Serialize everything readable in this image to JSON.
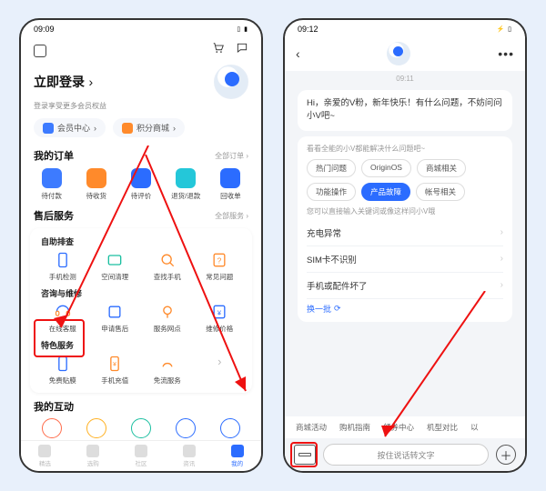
{
  "left": {
    "status": {
      "time": "09:09",
      "indicators": "⦿ ⦿ ⦿ ⦿",
      "batt": "▢"
    },
    "login": {
      "title": "立即登录",
      "chevron": "›",
      "subtitle": "登录享受更多会员权益"
    },
    "pills": {
      "member": "会员中心",
      "points": "积分商城",
      "chev": "›"
    },
    "orders": {
      "title": "我的订单",
      "more": "全部订单 ›",
      "items": [
        "待付款",
        "待收货",
        "待评价",
        "退货/退款",
        "回收单"
      ]
    },
    "after": {
      "title": "售后服务",
      "more": "全部服务 ›",
      "self_title": "自助排查",
      "self": [
        "手机检测",
        "空间清理",
        "查找手机",
        "常见问题"
      ],
      "cons_title": "咨询与维修",
      "cons": [
        "在线客服",
        "申请售后",
        "服务网点",
        "维修价格"
      ],
      "feat_title": "特色服务",
      "feat": [
        "免费贴膜",
        "手机充值",
        "免流服务"
      ]
    },
    "interact": {
      "title": "我的互动"
    },
    "nav": [
      "精选",
      "选购",
      "社区",
      "资讯",
      "我的"
    ]
  },
  "right": {
    "status": {
      "time": "09:12",
      "batt": "⚡▢"
    },
    "chat_time": "09:11",
    "greeting": "Hi，亲爱的V粉，新年快乐！有什么问题，不妨问问小V吧~",
    "panel_hint": "看看全能的小V都能解决什么问题吧~",
    "chips": [
      "热门问题",
      "OriginOS",
      "商城相关",
      "功能操作",
      "产品故障",
      "帐号相关"
    ],
    "chip_active_index": 4,
    "list_hint": "您可以直接输入关键词或像这样问小V哦",
    "list": [
      "充电异常",
      "SIM卡不识别",
      "手机或配件坏了"
    ],
    "refresh": "换一批",
    "tabs": [
      "商城活动",
      "购机指南",
      "领券中心",
      "机型对比",
      "以"
    ],
    "voice_placeholder": "按住说话转文字"
  }
}
